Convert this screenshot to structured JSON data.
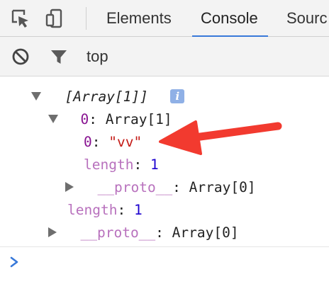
{
  "devtools": {
    "toolbar_icons": [
      "inspect-element-icon",
      "device-toolbar-icon"
    ],
    "tabs": [
      {
        "label": "Elements",
        "active": false
      },
      {
        "label": "Console",
        "active": true
      },
      {
        "label": "Sources",
        "active": false
      }
    ],
    "tab_partial_label": "Sourc"
  },
  "console_toolbar": {
    "icons": [
      "clear-console-icon",
      "filter-icon"
    ],
    "context": "top"
  },
  "output": {
    "header": "[Array[1]]",
    "info_badge": "i",
    "row0": {
      "key": "0",
      "sep": ": ",
      "value": "Array[1]"
    },
    "row0_0": {
      "key": "0",
      "sep": ": ",
      "value": "\"vv\""
    },
    "row0_length": {
      "key": "length",
      "sep": ": ",
      "value": "1"
    },
    "row0_proto": {
      "key": "__proto__",
      "sep": ": ",
      "value": "Array[0]"
    },
    "row_length": {
      "key": "length",
      "sep": ": ",
      "value": "1"
    },
    "row_proto": {
      "key": "__proto__",
      "sep": ": ",
      "value": "Array[0]"
    }
  },
  "prompt": {
    "caret": "prompt-caret-icon"
  },
  "colors": {
    "accent": "#3879d9",
    "string": "#c41a16",
    "number": "#1c00cf",
    "key": "#881391",
    "annotation_arrow": "#f23a2f"
  }
}
